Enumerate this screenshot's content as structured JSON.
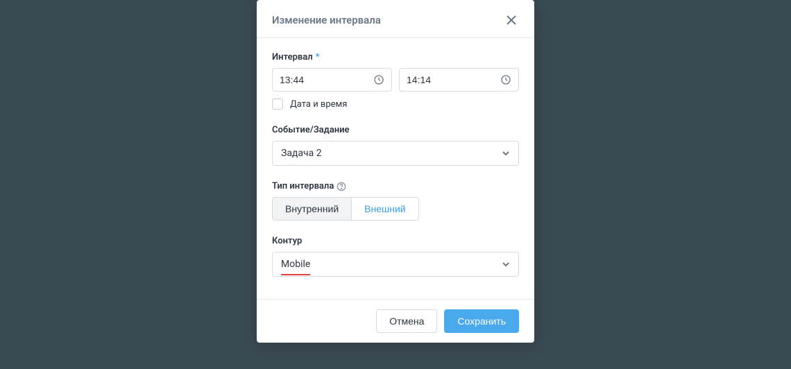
{
  "modal": {
    "title": "Изменение интервала",
    "interval": {
      "label": "Интервал",
      "required_marker": "*",
      "start_value": "13:44",
      "end_value": "14:14",
      "datetime_checkbox_label": "Дата и время"
    },
    "event_task": {
      "label": "Событие/Задание",
      "selected": "Задача 2"
    },
    "interval_type": {
      "label": "Тип интервала",
      "option_internal": "Внутренний",
      "option_external": "Внешний"
    },
    "contour": {
      "label": "Контур",
      "selected": "Mobile"
    },
    "buttons": {
      "cancel": "Отмена",
      "save": "Сохранить"
    }
  }
}
